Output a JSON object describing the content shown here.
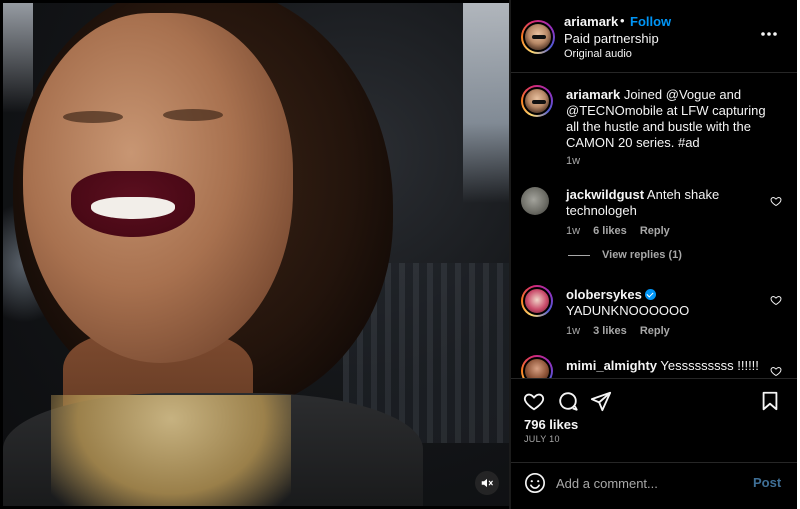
{
  "header": {
    "username": "ariamark",
    "dot": "•",
    "follow_label": "Follow",
    "subtitle": "Paid partnership",
    "audio": "Original audio",
    "more_icon": "more-horizontal-icon"
  },
  "caption": {
    "username": "ariamark",
    "text": " Joined @Vogue and @TECNOmobile at LFW capturing all the hustle and bustle with the CAMON 20 series. #ad",
    "time": "1w"
  },
  "comments": [
    {
      "username": "jackwildgust",
      "text": " Anteh shake technologeh",
      "time": "1w",
      "likes": "6 likes",
      "reply": "Reply",
      "view_replies": "View replies (1)"
    },
    {
      "username": "olobersykes",
      "verified": true,
      "text": "YADUNKNOOOOOO",
      "time": "1w",
      "likes": "3 likes",
      "reply": "Reply"
    },
    {
      "username": "mimi_almighty",
      "text": " Yesssssssss !!!!!!"
    }
  ],
  "actions": {
    "icons": [
      "heart-icon",
      "comment-icon",
      "share-icon",
      "bookmark-icon"
    ],
    "likes": "796 likes",
    "date": "JULY 10"
  },
  "add_comment": {
    "placeholder": "Add a comment...",
    "post_label": "Post",
    "emoji_icon": "emoji-icon"
  },
  "media": {
    "mute_icon": "muted-speaker-icon"
  },
  "colors": {
    "accent": "#0095f6",
    "post_disabled": "#3f6f96",
    "muted_text": "#a8a8a8"
  }
}
